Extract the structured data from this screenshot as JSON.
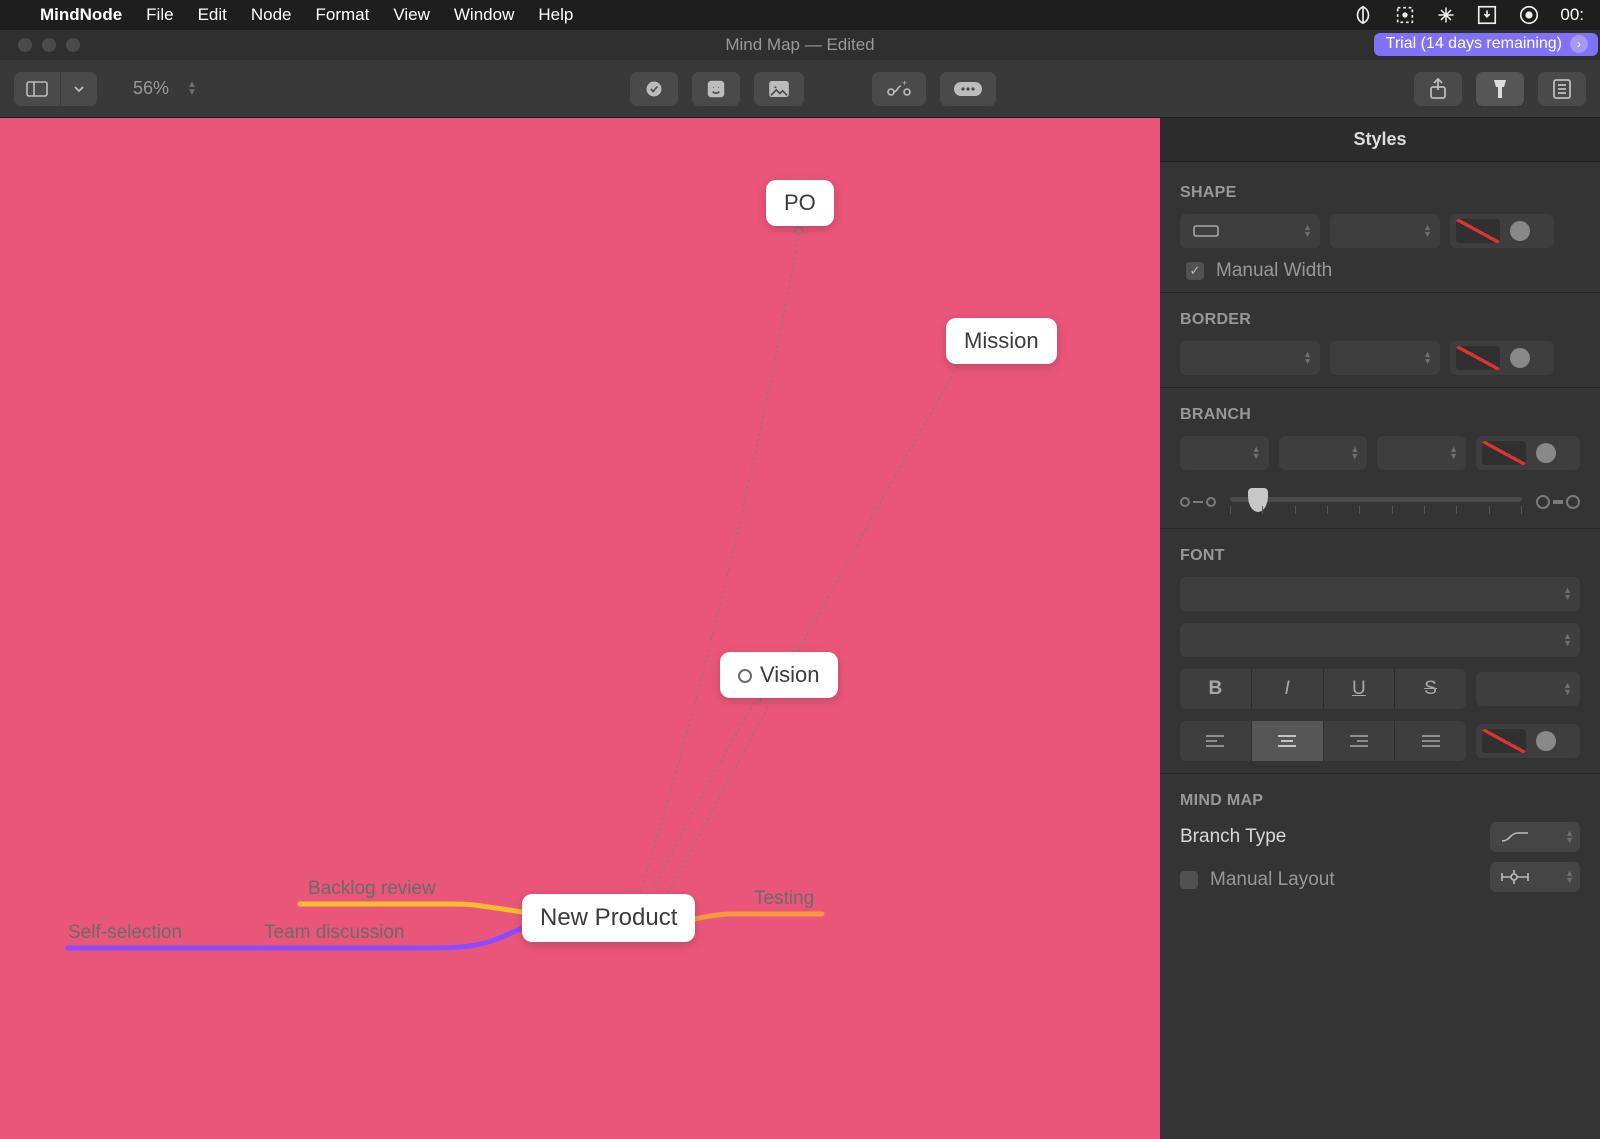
{
  "menubar": {
    "app_name": "MindNode",
    "items": [
      "File",
      "Edit",
      "Node",
      "Format",
      "View",
      "Window",
      "Help"
    ],
    "clock": "00:"
  },
  "window": {
    "title": "Mind Map — Edited",
    "trial": "Trial (14 days remaining)"
  },
  "toolbar": {
    "zoom": "56%"
  },
  "canvas": {
    "nodes": {
      "center": "New Product",
      "po": "PO",
      "mission": "Mission",
      "vision": "Vision"
    },
    "branches": {
      "backlog": "Backlog review",
      "team": "Team discussion",
      "self": "Self-selection",
      "testing": "Testing"
    }
  },
  "panel": {
    "header": "Styles",
    "shape": "SHAPE",
    "manual_width": "Manual Width",
    "border": "BORDER",
    "branch": "BRANCH",
    "font": "FONT",
    "mindmap": "MIND MAP",
    "branch_type": "Branch Type",
    "manual_layout": "Manual Layout"
  }
}
